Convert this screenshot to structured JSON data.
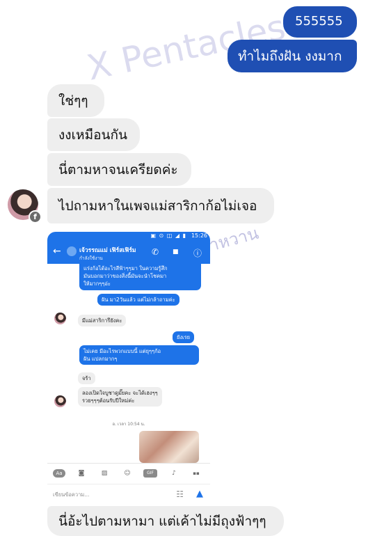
{
  "watermarks": {
    "main": "X Pentacles",
    "secondary": "น้ำหวาน"
  },
  "messages": {
    "out1": "555555",
    "out2": "ทำไมถึงฝัน งงมาก",
    "in1": "ใช่ๆๆ",
    "in2": "งงเหมือนกัน",
    "in3": "นี่ตามหาจนเครียดค่ะ",
    "in4": "ไปถามหาในเพจแม่สาริกาก้อไม่เจอ",
    "in5": "นี่อ้ะไปตามหามา แต่เค้าไม่มีถุงฟ้าๆๆ"
  },
  "phone": {
    "status_time": "15:26",
    "status_icons": "▣ ⊙ ◫ ◢ ▮",
    "contact_name": "เจ้วรรณแม่ เฟิร์สเฟิร์ม",
    "contact_status": "กำลังใช้งาน",
    "back_icon": "←",
    "call_icon": "✆",
    "video_icon": "■",
    "info_icon": "ⓘ",
    "msg_top": [
      "แร่งก้อได้อะไรสีฟ้าๆๆมา ในความรู้สึก",
      "มันบอกมาว่าของสิ่งนี้มันจะนำโชคมา",
      "ให้มากๆๆอ่ะ"
    ],
    "msg_out1": "ฝัน มา2วันแล้ว แต่ไม่กล้าถามค่ะ",
    "msg_in1": "มีแม่สาริการึยังคะ",
    "msg_out2": "ยังเรย",
    "msg_out3": [
      "ไม่เคย มีอะไรพวกแบบนี้ แต่ยุๆๆก้อ",
      "ฝัน แปลกมากๆ"
    ],
    "msg_in2": "จร้า",
    "msg_in3": [
      "ลองเปิดใจบูชาดูมั๊ยคะ จะได้เฮงๆๆ",
      "รวยๆๆๆต้อนรับปีใหม่ค่ะ"
    ],
    "timestamp": "อ. เวลา 10:54 น.",
    "toolbar_icons": [
      "Aa",
      "◙",
      "▨",
      "☺",
      "GIF",
      "♪",
      "▪▪"
    ],
    "input_placeholder": "เขียนข้อความ...",
    "emoji_icon": "☷",
    "like_icon": "▲"
  },
  "colors": {
    "outgoing": "#1f4fb3",
    "incoming": "#eeeeee",
    "messenger_blue": "#1e73e8"
  }
}
